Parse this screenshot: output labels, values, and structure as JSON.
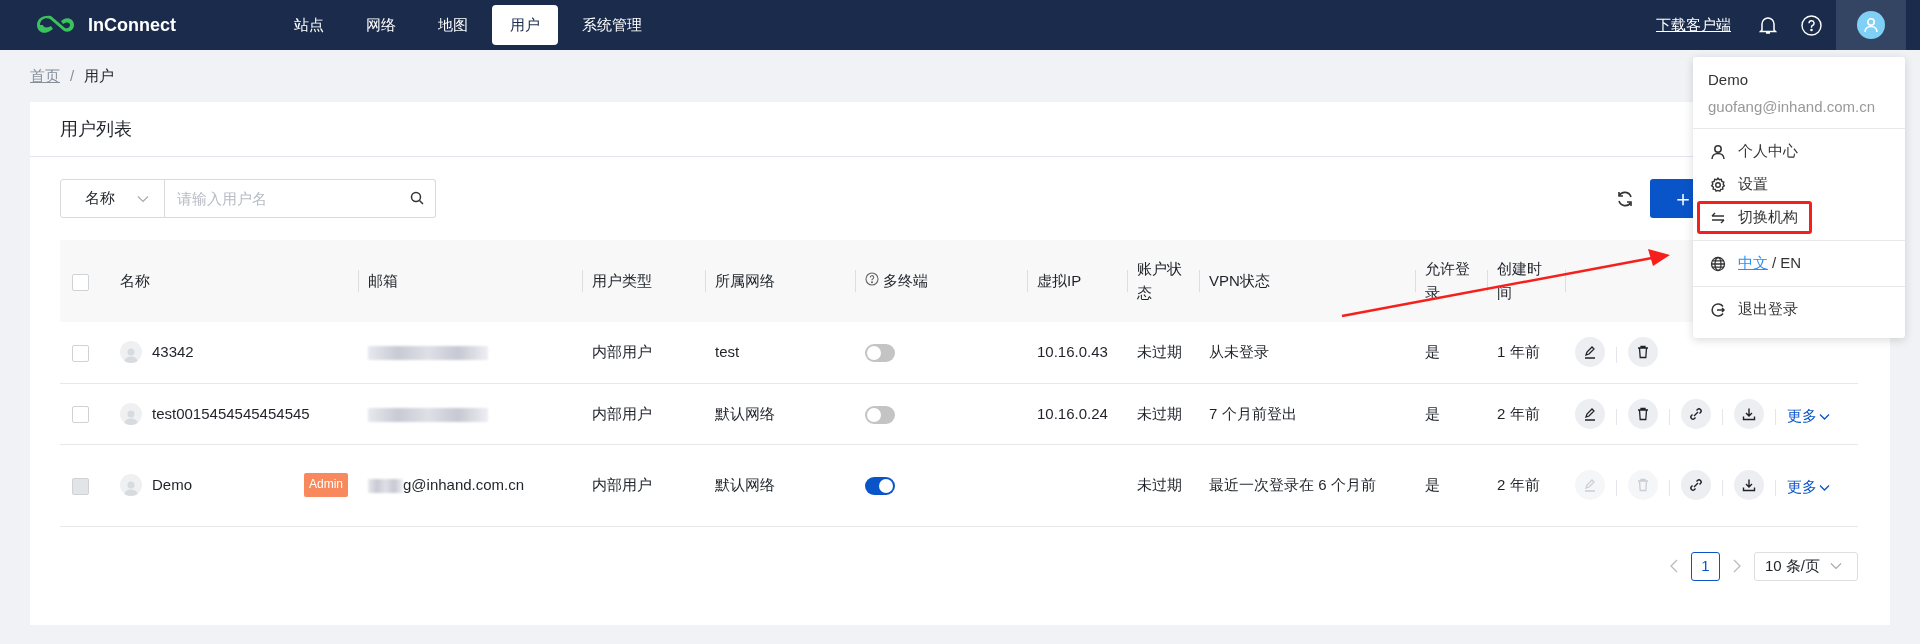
{
  "brand": {
    "name": "InConnect"
  },
  "nav": [
    {
      "label": "站点",
      "selected": false
    },
    {
      "label": "网络",
      "selected": false
    },
    {
      "label": "地图",
      "selected": false
    },
    {
      "label": "用户",
      "selected": true
    },
    {
      "label": "系统管理",
      "selected": false
    }
  ],
  "header_right": {
    "download": "下载客户端"
  },
  "breadcrumb": [
    {
      "label": "首页",
      "current": false
    },
    {
      "label": "用户",
      "current": true
    }
  ],
  "separator": "/",
  "card": {
    "title": "用户列表"
  },
  "filter": {
    "field": "名称",
    "placeholder": "请输入用户名"
  },
  "add_button": {
    "label": "＋"
  },
  "select_all": {
    "checked": false
  },
  "table": {
    "columns": [
      {
        "label": "名称"
      },
      {
        "label": "邮箱"
      },
      {
        "label": "用户类型"
      },
      {
        "label": "所属网络"
      },
      {
        "label": "多终端",
        "help": true
      },
      {
        "label": "虚拟IP"
      },
      {
        "label": "账户状态"
      },
      {
        "label": "VPN状态"
      },
      {
        "label": "允许登录"
      },
      {
        "label": "创建时间"
      }
    ],
    "rows": [
      {
        "checked": false,
        "checkbox_disabled": false,
        "name": "43342",
        "email_blurred": true,
        "user_type": "内部用户",
        "network": "test",
        "multi_terminal": false,
        "virtual_ip": "10.16.0.43",
        "account_status": "未过期",
        "vpn_status": "从未登录",
        "allow_login": "是",
        "created": "1 年前",
        "actions": [
          {
            "kind": "edit",
            "disabled": false
          },
          {
            "kind": "delete",
            "disabled": false
          }
        ]
      },
      {
        "checked": false,
        "checkbox_disabled": false,
        "name": "test0015454545454545",
        "email_blurred": true,
        "user_type": "内部用户",
        "network": "默认网络",
        "multi_terminal": false,
        "virtual_ip": "10.16.0.24",
        "account_status": "未过期",
        "vpn_status": "7 个月前登出",
        "allow_login": "是",
        "created": "2 年前",
        "actions": [
          {
            "kind": "edit",
            "disabled": false
          },
          {
            "kind": "delete",
            "disabled": false
          },
          {
            "kind": "link",
            "disabled": false
          },
          {
            "kind": "download",
            "disabled": false
          }
        ],
        "more": "更多"
      },
      {
        "checked": false,
        "checkbox_disabled": true,
        "name": "Demo",
        "badge": "Admin",
        "email_blurred": true,
        "email": "g@inhand.com.cn",
        "user_type": "内部用户",
        "network": "默认网络",
        "multi_terminal": true,
        "account_status": "未过期",
        "vpn_status": "最近一次登录在 6 个月前",
        "allow_login": "是",
        "created": "2 年前",
        "actions": [
          {
            "kind": "edit",
            "disabled": true
          },
          {
            "kind": "delete",
            "disabled": true
          },
          {
            "kind": "link",
            "disabled": false
          },
          {
            "kind": "download",
            "disabled": false
          }
        ],
        "more": "更多"
      }
    ]
  },
  "pagination": {
    "pages": [
      {
        "label": "1",
        "selected": true
      }
    ],
    "page_size": "10 条/页"
  },
  "user_menu": {
    "name": "Demo",
    "email": "guofang@inhand.com.cn",
    "groups": [
      [
        {
          "kind": "person",
          "label": "个人中心",
          "highlighted": false
        },
        {
          "kind": "gear",
          "label": "设置",
          "highlighted": false
        },
        {
          "kind": "swap",
          "label": "切换机构",
          "highlighted": true
        }
      ],
      [
        {
          "kind": "language",
          "options": [
            {
              "label": "中文",
              "selected": true
            },
            {
              "label": "EN",
              "selected": false
            }
          ]
        }
      ],
      [
        {
          "kind": "logout",
          "label": "退出登录",
          "highlighted": false
        }
      ]
    ]
  },
  "annotation_arrow": true
}
